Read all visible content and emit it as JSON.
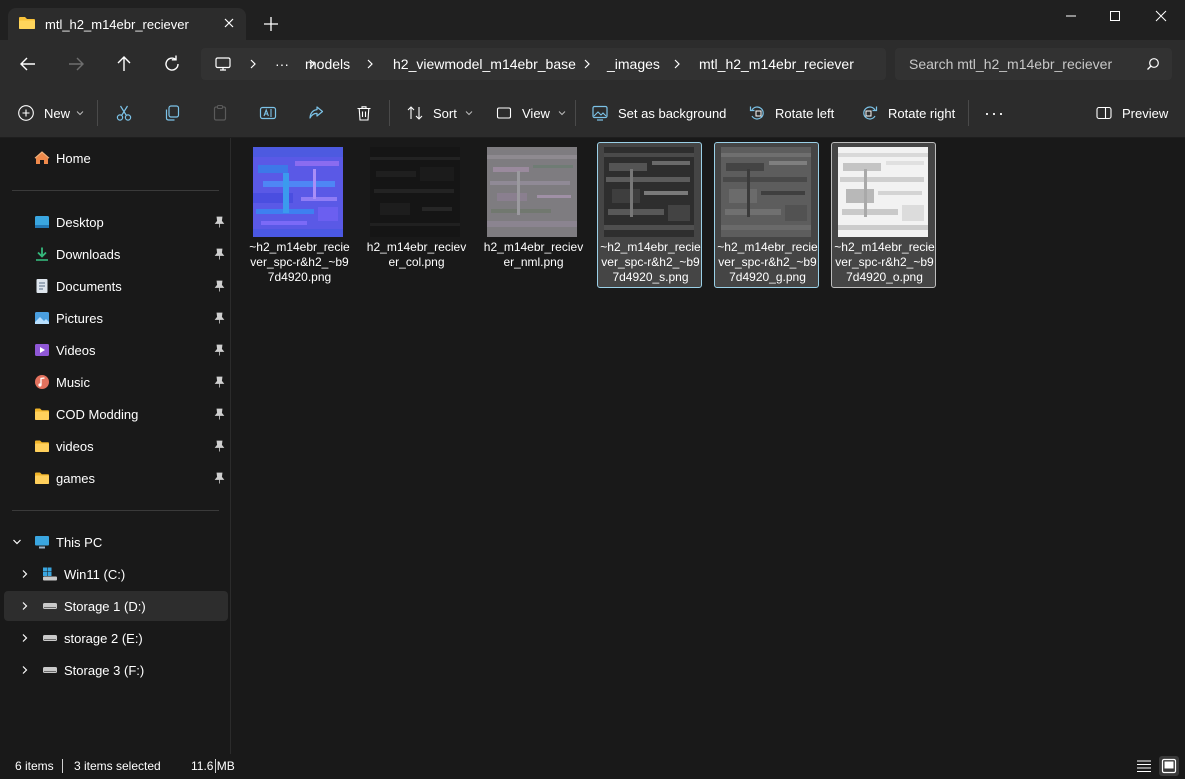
{
  "window": {
    "tab_title": "mtl_h2_m14ebr_reciever",
    "controls": [
      "minimize",
      "maximize",
      "close"
    ]
  },
  "breadcrumb": {
    "overflow": "···",
    "items": [
      "models",
      "h2_viewmodel_m14ebr_base",
      "_images",
      "mtl_h2_m14ebr_reciever"
    ]
  },
  "search": {
    "placeholder": "Search mtl_h2_m14ebr_reciever"
  },
  "toolbar": {
    "new_label": "New",
    "sort_label": "Sort",
    "view_label": "View",
    "set_background_label": "Set as background",
    "rotate_left_label": "Rotate left",
    "rotate_right_label": "Rotate right",
    "more_label": "···",
    "preview_label": "Preview"
  },
  "sidebar": {
    "home": "Home",
    "quick_access": [
      {
        "label": "Desktop",
        "icon": "desktop-icon"
      },
      {
        "label": "Downloads",
        "icon": "downloads-icon"
      },
      {
        "label": "Documents",
        "icon": "documents-icon"
      },
      {
        "label": "Pictures",
        "icon": "pictures-icon"
      },
      {
        "label": "Videos",
        "icon": "videos-icon"
      },
      {
        "label": "Music",
        "icon": "music-icon"
      },
      {
        "label": "COD Modding",
        "icon": "folder-icon"
      },
      {
        "label": "videos",
        "icon": "folder-icon"
      },
      {
        "label": "games",
        "icon": "folder-icon"
      }
    ],
    "this_pc": "This PC",
    "drives": [
      {
        "label": "Win11 (C:)",
        "selected": false
      },
      {
        "label": "Storage 1 (D:)",
        "selected": true
      },
      {
        "label": "storage 2 (E:)",
        "selected": false
      },
      {
        "label": "Storage 3 (F:)",
        "selected": false
      }
    ]
  },
  "files": [
    {
      "name": "~h2_m14ebr_reciever_spc-r&h2_~b97d4920.png",
      "thumb": "normal-blue",
      "state": "none"
    },
    {
      "name": "h2_m14ebr_reciever_col.png",
      "thumb": "dark",
      "state": "none"
    },
    {
      "name": "h2_m14ebr_reciever_nml.png",
      "thumb": "gray-noise",
      "state": "none"
    },
    {
      "name": "~h2_m14ebr_reciever_spc-r&h2_~b97d4920_s.png",
      "thumb": "dark-gray",
      "state": "selected"
    },
    {
      "name": "~h2_m14ebr_reciever_spc-r&h2_~b97d4920_g.png",
      "thumb": "mid-gray",
      "state": "selected"
    },
    {
      "name": "~h2_m14ebr_reciever_spc-r&h2_~b97d4920_o.png",
      "thumb": "white",
      "state": "selected-focused"
    }
  ],
  "status": {
    "item_count": "6 items",
    "selection": "3 items selected",
    "size": "11.6 MB"
  },
  "colors": {
    "accent_folder": "#f8c23a",
    "selection_border": "#9ad0e7",
    "selection_bg": "#454545"
  }
}
